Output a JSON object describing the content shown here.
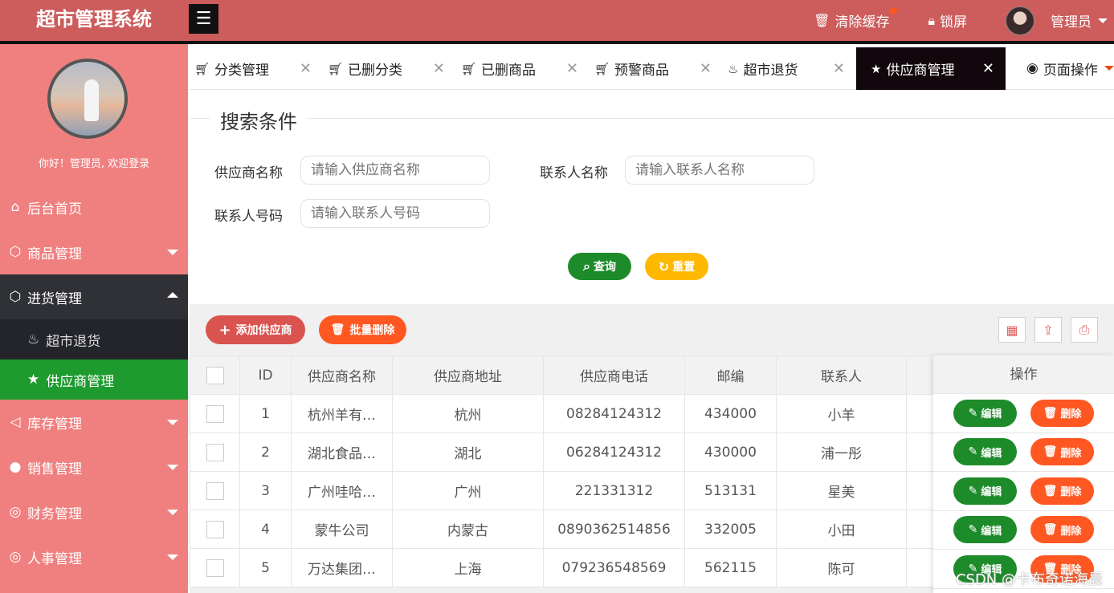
{
  "app": {
    "title": "超市管理系统",
    "menu_toggle": "☰"
  },
  "header": {
    "clear_cache": "清除缓存",
    "lock": "锁屏",
    "user": "管理员"
  },
  "sidebar": {
    "welcome": "你好！管理员, 欢迎登录",
    "items": [
      {
        "label": "后台首页",
        "icon": "home-icon"
      },
      {
        "label": "商品管理",
        "icon": "cube-icon"
      },
      {
        "label": "进货管理",
        "icon": "cube-icon"
      },
      {
        "label": "超市退货",
        "icon": "fire-icon"
      },
      {
        "label": "供应商管理",
        "icon": "star-icon"
      },
      {
        "label": "库存管理",
        "icon": "speaker-icon"
      },
      {
        "label": "销售管理",
        "icon": "chat-icon"
      },
      {
        "label": "财务管理",
        "icon": "finance-icon"
      },
      {
        "label": "人事管理",
        "icon": "finance-icon"
      }
    ]
  },
  "tabs": [
    {
      "label": "分类管理"
    },
    {
      "label": "已删分类"
    },
    {
      "label": "已删商品"
    },
    {
      "label": "预警商品"
    },
    {
      "label": "超市退货"
    },
    {
      "label": "供应商管理"
    }
  ],
  "tab_ops": "页面操作",
  "search": {
    "legend": "搜索条件",
    "supplier_name_label": "供应商名称",
    "supplier_name_placeholder": "请输入供应商名称",
    "contact_name_label": "联系人名称",
    "contact_name_placeholder": "请输入联系人名称",
    "contact_phone_label": "联系人号码",
    "contact_phone_placeholder": "请输入联系人号码",
    "query": "查询",
    "reset": "重置"
  },
  "toolbar": {
    "add": "添加供应商",
    "batch_delete": "批量删除"
  },
  "table": {
    "headers": [
      "ID",
      "供应商名称",
      "供应商地址",
      "供应商电话",
      "邮编",
      "联系人",
      "操作"
    ],
    "rows": [
      {
        "id": "1",
        "name": "杭州羊有…",
        "address": "杭州",
        "phone": "08284124312",
        "zip": "434000",
        "contact": "小羊"
      },
      {
        "id": "2",
        "name": "湖北食品…",
        "address": "湖北",
        "phone": "06284124312",
        "zip": "430000",
        "contact": "浦一彤"
      },
      {
        "id": "3",
        "name": "广州哇哈…",
        "address": "广州",
        "phone": "221331312",
        "zip": "513131",
        "contact": "星美"
      },
      {
        "id": "4",
        "name": "蒙牛公司",
        "address": "内蒙古",
        "phone": "0890362514856",
        "zip": "332005",
        "contact": "小田"
      },
      {
        "id": "5",
        "name": "万达集团…",
        "address": "上海",
        "phone": "079236548569",
        "zip": "562115",
        "contact": "陈可"
      }
    ],
    "edit": "编辑",
    "delete": "删除"
  },
  "watermark": "CSDN @卡布奇诺海晨",
  "colors": {
    "header": "#cd5c5c",
    "sidebar": "#f08080",
    "active_green": "#1e9b2f",
    "orange": "#ff5722",
    "yellow": "#ffb800"
  }
}
